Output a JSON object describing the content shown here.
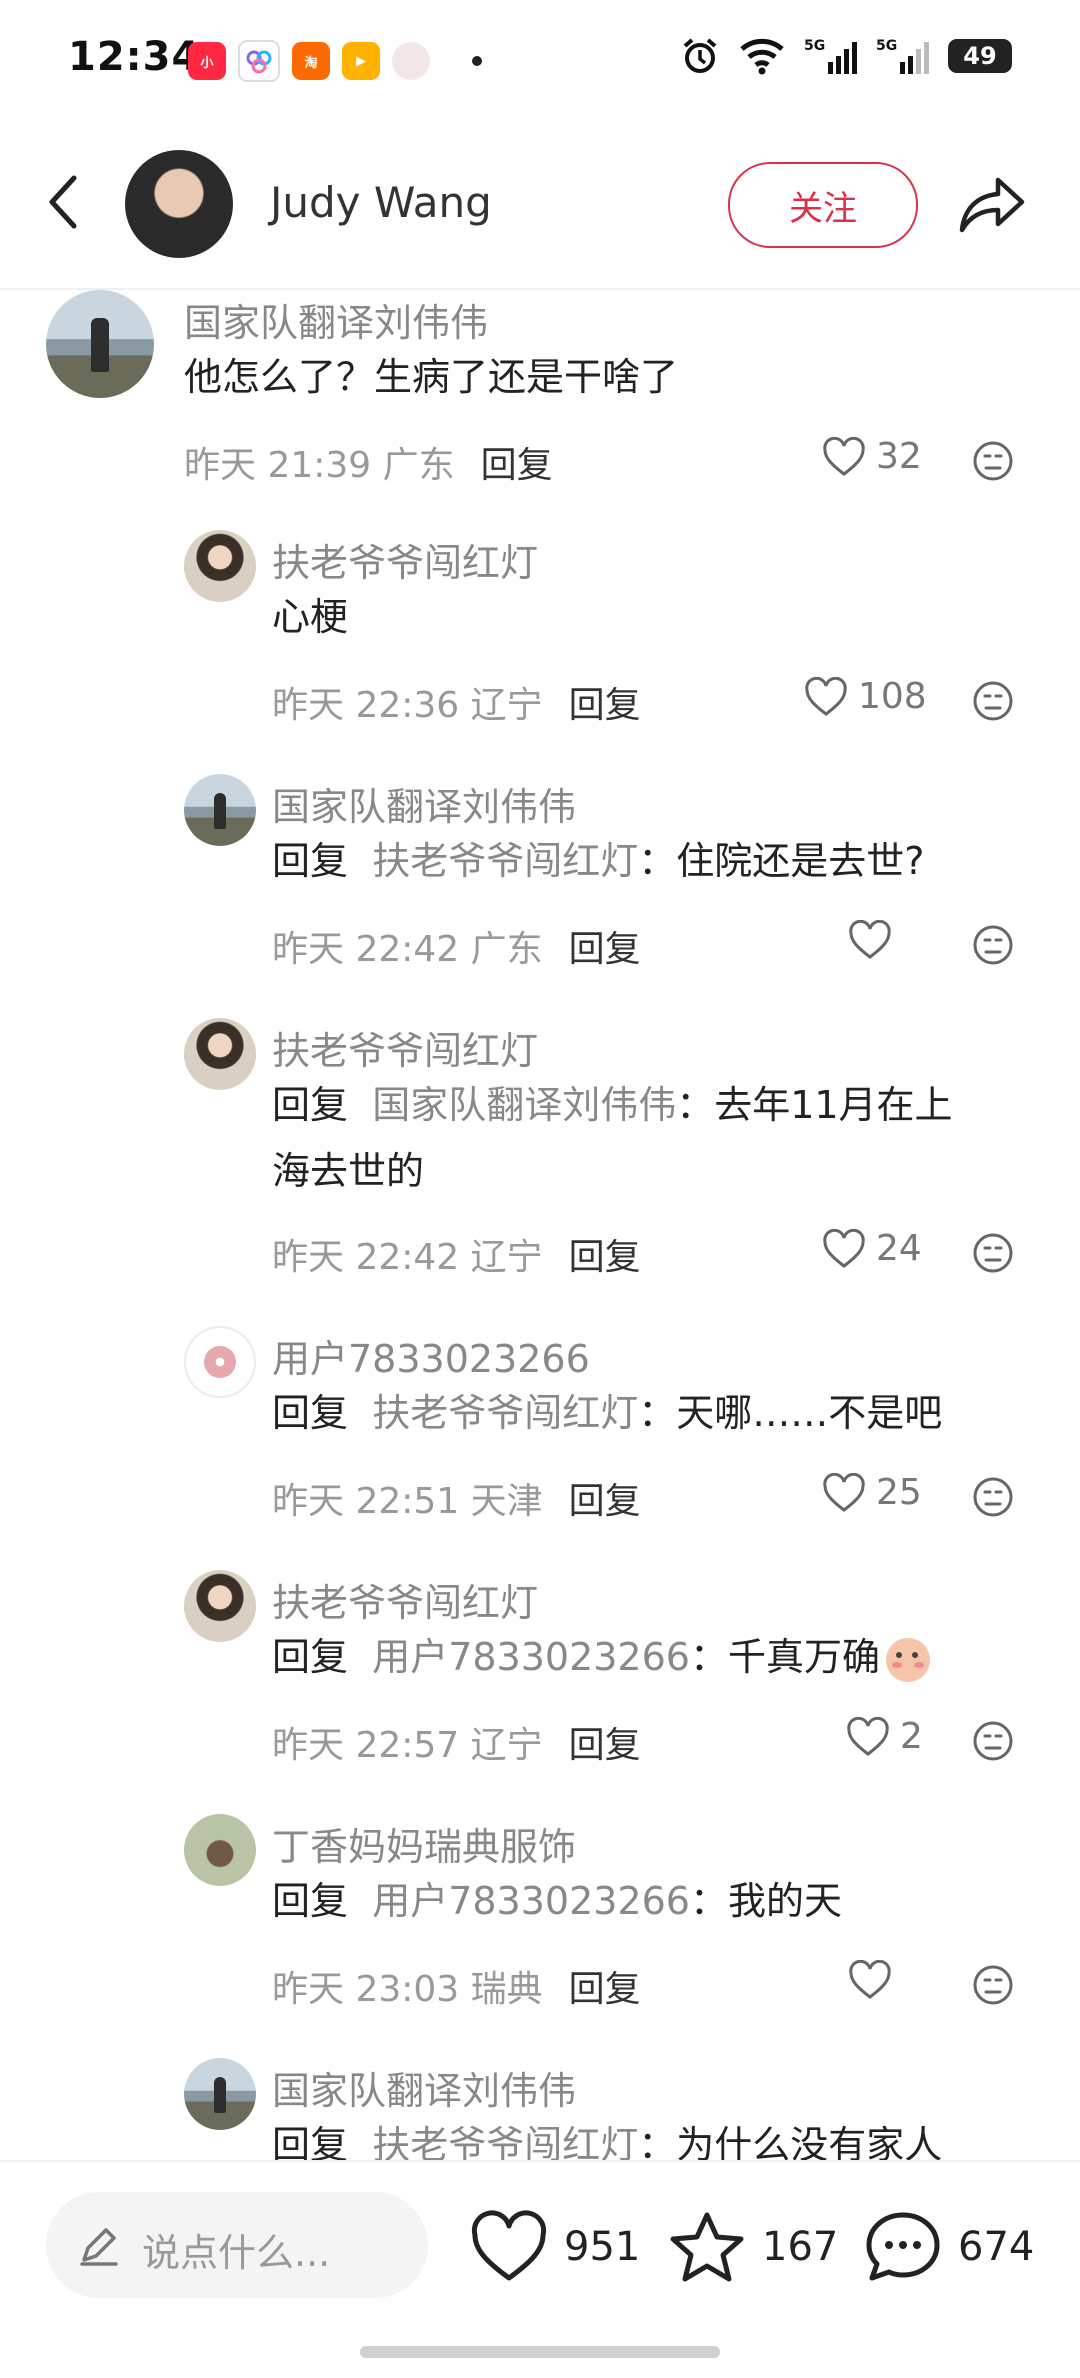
{
  "status_bar": {
    "time": "12:34",
    "battery": "49",
    "network": [
      "5G",
      "5G"
    ]
  },
  "header": {
    "user_name": "Judy Wang",
    "follow_label": "关注"
  },
  "comments": [
    {
      "nick": "国家队翻译刘伟伟",
      "reply_kw": "",
      "target": "",
      "text": "他怎么了？生病了还是干啥了",
      "line2": "",
      "time": "昨天 21:39",
      "location": "广东",
      "reply_label": "回复",
      "likes": "32"
    },
    {
      "nick": "扶老爷爷闯红灯",
      "reply_kw": "",
      "target": "",
      "text": "心梗",
      "line2": "",
      "time": "昨天 22:36",
      "location": "辽宁",
      "reply_label": "回复",
      "likes": "108"
    },
    {
      "nick": "国家队翻译刘伟伟",
      "reply_kw": "回复",
      "target": "扶老爷爷闯红灯",
      "text": "：住院还是去世?",
      "line2": "",
      "time": "昨天 22:42",
      "location": "广东",
      "reply_label": "回复",
      "likes": ""
    },
    {
      "nick": "扶老爷爷闯红灯",
      "reply_kw": "回复",
      "target": "国家队翻译刘伟伟",
      "text": "：去年11月在上",
      "line2": "海去世的",
      "time": "昨天 22:42",
      "location": "辽宁",
      "reply_label": "回复",
      "likes": "24"
    },
    {
      "nick": "用户7833023266",
      "reply_kw": "回复",
      "target": "扶老爷爷闯红灯",
      "text": "：天哪……不是吧",
      "line2": "",
      "time": "昨天 22:51",
      "location": "天津",
      "reply_label": "回复",
      "likes": "25"
    },
    {
      "nick": "扶老爷爷闯红灯",
      "reply_kw": "回复",
      "target": "用户7833023266",
      "text": "：千真万确",
      "line2": "",
      "time": "昨天 22:57",
      "location": "辽宁",
      "reply_label": "回复",
      "likes": "2"
    },
    {
      "nick": "丁香妈妈瑞典服饰",
      "reply_kw": "回复",
      "target": "用户7833023266",
      "text": "：我的天",
      "line2": "",
      "time": "昨天 23:03",
      "location": "瑞典",
      "reply_label": "回复",
      "likes": ""
    },
    {
      "nick": "国家队翻译刘伟伟",
      "reply_kw": "回复",
      "target": "扶老爷爷闯红灯",
      "text": "：为什么没有家人",
      "line2": "",
      "time": "",
      "location": "",
      "reply_label": "",
      "likes": ""
    }
  ],
  "bottom": {
    "placeholder": "说点什么...",
    "likes": "951",
    "stars": "167",
    "comments": "674"
  }
}
